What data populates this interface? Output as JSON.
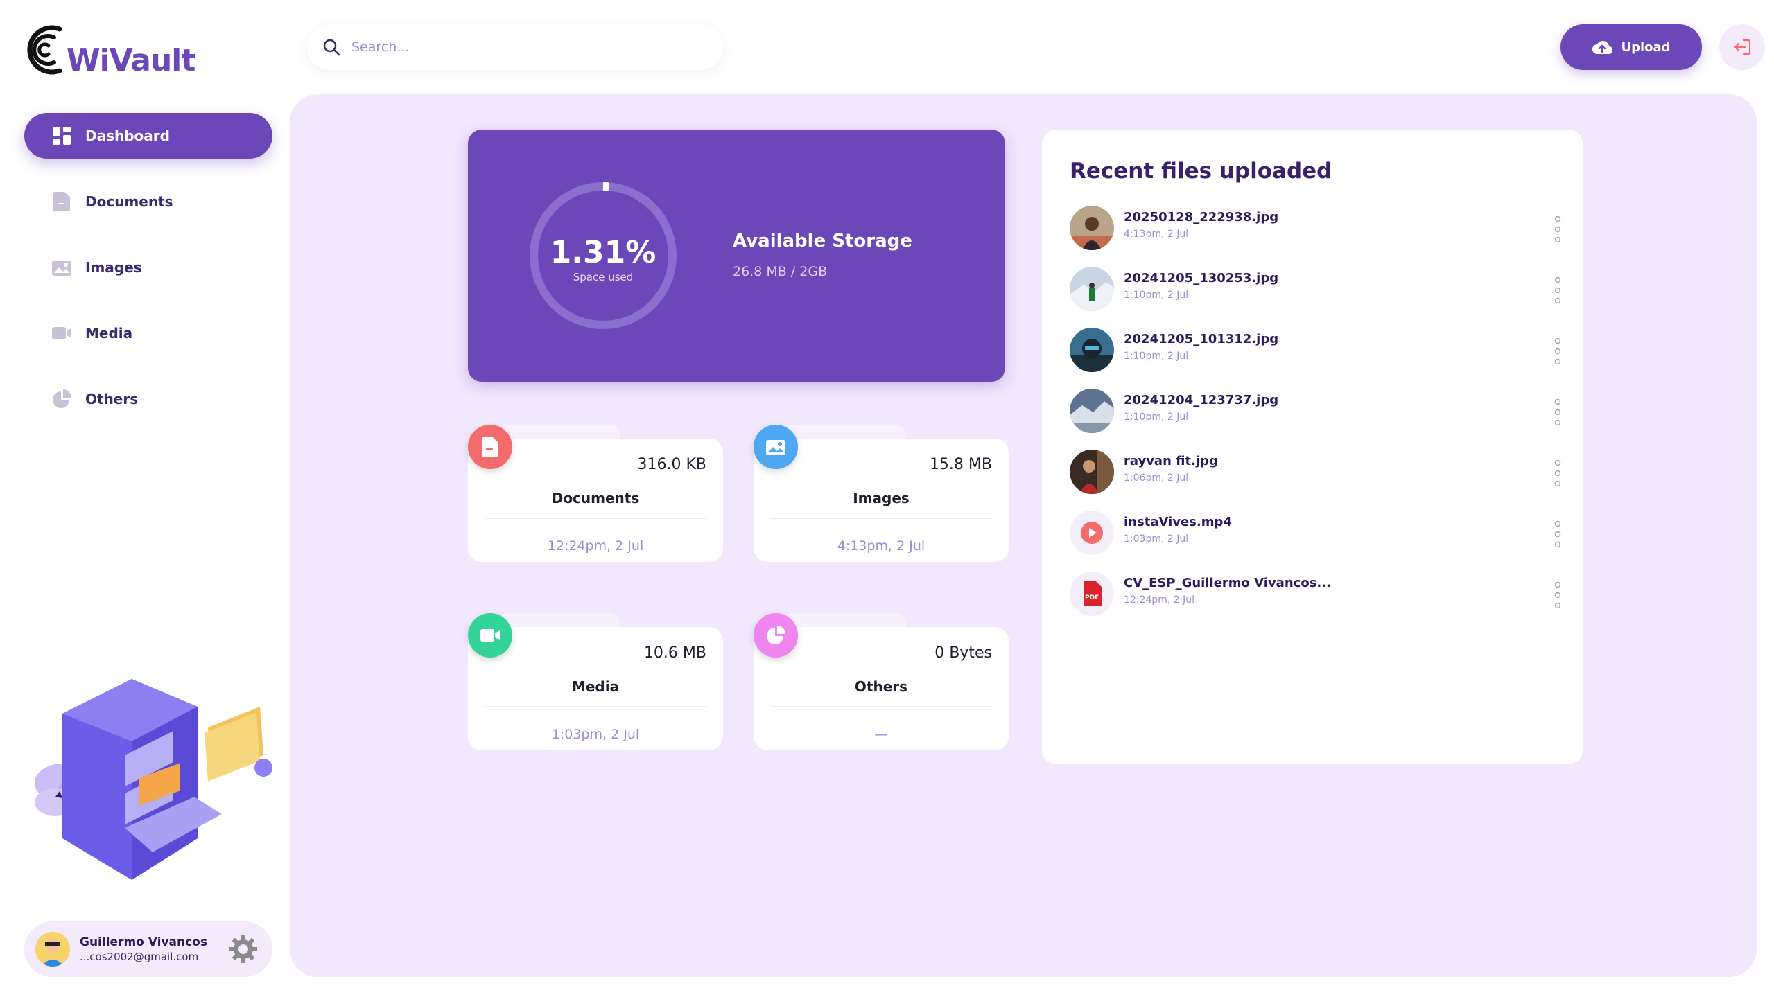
{
  "app": {
    "logo_text": "WiVault"
  },
  "sidebar": {
    "items": [
      {
        "label": "Dashboard",
        "icon": "dashboard-icon",
        "active": true
      },
      {
        "label": "Documents",
        "icon": "document-icon",
        "active": false
      },
      {
        "label": "Images",
        "icon": "image-icon",
        "active": false
      },
      {
        "label": "Media",
        "icon": "video-icon",
        "active": false
      },
      {
        "label": "Others",
        "icon": "pie-icon",
        "active": false
      }
    ],
    "user": {
      "name": "Guillermo Vivancos",
      "email": "...cos2002@gmail.com"
    }
  },
  "header": {
    "search_placeholder": "Search...",
    "upload_label": "Upload"
  },
  "storage": {
    "percent_label": "1.31%",
    "percent_value": 1.31,
    "sub_label": "Space used",
    "title": "Available Storage",
    "size": "26.8 MB / 2GB"
  },
  "categories": [
    {
      "label": "Documents",
      "size": "316.0 KB",
      "date": "12:24pm, 2 Jul",
      "icon": "document-icon",
      "color": "#f36b6b"
    },
    {
      "label": "Images",
      "size": "15.8 MB",
      "date": "4:13pm, 2 Jul",
      "icon": "image-icon",
      "color": "#4ea7f2"
    },
    {
      "label": "Media",
      "size": "10.6 MB",
      "date": "1:03pm, 2 Jul",
      "icon": "video-icon",
      "color": "#34d39a"
    },
    {
      "label": "Others",
      "size": "0 Bytes",
      "date": "—",
      "icon": "pie-icon",
      "color": "#ef86f0"
    }
  ],
  "recent": {
    "title": "Recent files uploaded",
    "files": [
      {
        "name": "20250128_222938.jpg",
        "date": "4:13pm, 2 Jul",
        "type": "image"
      },
      {
        "name": "20241205_130253.jpg",
        "date": "1:10pm, 2 Jul",
        "type": "image"
      },
      {
        "name": "20241205_101312.jpg",
        "date": "1:10pm, 2 Jul",
        "type": "image"
      },
      {
        "name": "20241204_123737.jpg",
        "date": "1:10pm, 2 Jul",
        "type": "image"
      },
      {
        "name": "rayvan fit.jpg",
        "date": "1:06pm, 2 Jul",
        "type": "image"
      },
      {
        "name": "instaVives.mp4",
        "date": "1:03pm, 2 Jul",
        "type": "video"
      },
      {
        "name": "CV_ESP_Guillermo Vivancos...",
        "date": "12:24pm, 2 Jul",
        "type": "pdf",
        "badge": "PDF"
      }
    ]
  },
  "colors": {
    "accent": "#6b47b8",
    "main_bg": "#f2e8fd"
  }
}
